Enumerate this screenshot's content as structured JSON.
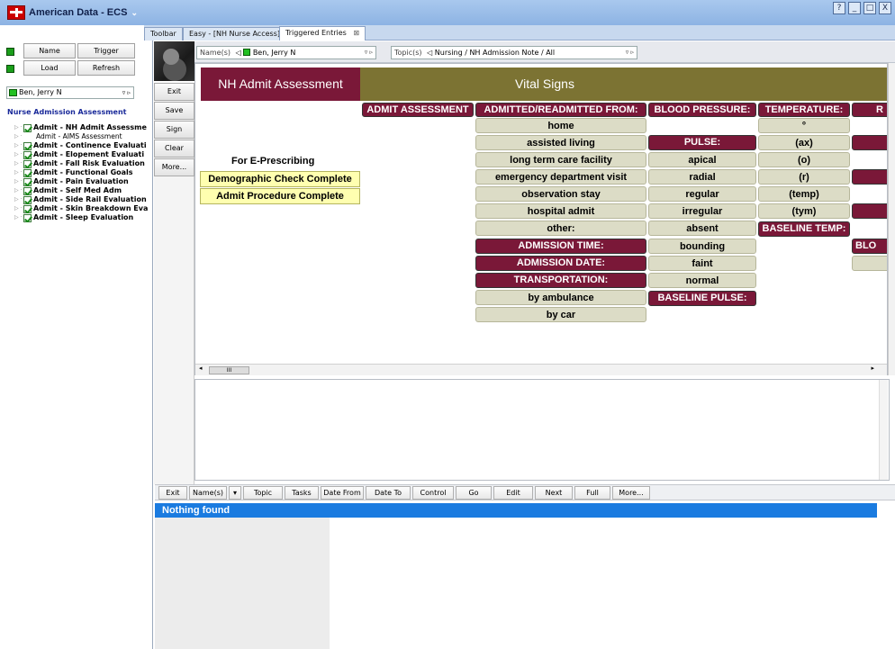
{
  "app": {
    "title": "American Data - ECS",
    "window_controls": [
      "?",
      "_",
      "□",
      "X"
    ]
  },
  "tabs": [
    {
      "label": "Toolbar"
    },
    {
      "label": "Easy - [NH Nurse Access]"
    },
    {
      "label": "Triggered Entries",
      "close": "⊠"
    }
  ],
  "left_panel": {
    "buttons": {
      "name": "Name",
      "trigger": "Trigger",
      "load": "Load",
      "refresh": "Refresh"
    },
    "patient": "Ben, Jerry N",
    "section_title": "Nurse Admission Assessment",
    "tree": [
      {
        "label": "Admit - NH Admit Assessme",
        "checked": true,
        "bold": true
      },
      {
        "label": "Admit - AIMS Assessment",
        "checked": false,
        "bold": false
      },
      {
        "label": "Admit - Continence Evaluati",
        "checked": true,
        "bold": true
      },
      {
        "label": "Admit - Elopement Evaluati",
        "checked": true,
        "bold": true
      },
      {
        "label": "Admit - Fall Risk Evaluation",
        "checked": true,
        "bold": true
      },
      {
        "label": "Admit - Functional Goals",
        "checked": true,
        "bold": true
      },
      {
        "label": "Admit - Pain Evaluation",
        "checked": true,
        "bold": true
      },
      {
        "label": "Admit - Self Med Adm",
        "checked": true,
        "bold": true
      },
      {
        "label": "Admit - Side Rail Evaluation",
        "checked": true,
        "bold": true
      },
      {
        "label": "Admit - Skin Breakdown Eva",
        "checked": true,
        "bold": true
      },
      {
        "label": "Admit - Sleep Evaluation",
        "checked": true,
        "bold": true
      }
    ]
  },
  "side_buttons": [
    "Exit",
    "Save",
    "Sign",
    "Clear",
    "More..."
  ],
  "selectors": {
    "names_label": "Name(s)",
    "name_value": "Ben, Jerry N",
    "topics_label": "Topic(s)",
    "topic_value": "Nursing / NH Admission Note / All"
  },
  "form": {
    "header_left": "NH Admit Assessment",
    "header_right": "Vital Signs",
    "admit_assessment": "ADMIT ASSESSMENT",
    "e_prescribing": "For E-Prescribing",
    "demographic": "Demographic Check Complete",
    "procedure": "Admit Procedure Complete",
    "admitted_from": {
      "header": "ADMITTED/READMITTED FROM:",
      "options": [
        "home",
        "assisted living",
        "long term care facility",
        "emergency department visit",
        "observation stay",
        "hospital admit",
        "other:"
      ]
    },
    "admission_time": "ADMISSION TIME:",
    "admission_date": "ADMISSION DATE:",
    "transportation": {
      "header": "TRANSPORTATION:",
      "options": [
        "by ambulance",
        "by car"
      ]
    },
    "blood_pressure": "BLOOD PRESSURE:",
    "pulse": {
      "header": "PULSE:",
      "options": [
        "apical",
        "radial",
        "regular",
        "irregular",
        "absent",
        "bounding",
        "faint",
        "normal"
      ]
    },
    "baseline_pulse": "BASELINE PULSE:",
    "temperature": {
      "header": "TEMPERATURE:",
      "options": [
        "°",
        "(ax)",
        "(o)",
        "(r)",
        "(temp)",
        "(tym)"
      ]
    },
    "baseline_temp": "BASELINE TEMP:",
    "partial_col": {
      "header": "R",
      "bottom": "BLO"
    }
  },
  "bottom_toolbar": [
    "Exit",
    "Name(s)",
    "▾",
    "Topic",
    "Tasks",
    "Date From",
    "Date To",
    "Control",
    "Go",
    "Edit",
    "Next",
    "Full",
    "More..."
  ],
  "nothing_found": "Nothing found",
  "scroll_thumb": "III"
}
